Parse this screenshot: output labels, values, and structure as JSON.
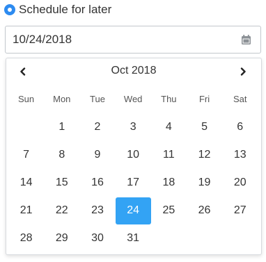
{
  "schedule": {
    "label": "Schedule for later",
    "selected": true
  },
  "date_input": {
    "value": "10/24/2018",
    "icon": "calendar-icon"
  },
  "calendar": {
    "month_title": "Oct 2018",
    "prev_icon": "chevron-left-icon",
    "next_icon": "chevron-right-icon",
    "weekdays": [
      "Sun",
      "Mon",
      "Tue",
      "Wed",
      "Thu",
      "Fri",
      "Sat"
    ],
    "first_weekday_index": 1,
    "days": [
      "1",
      "2",
      "3",
      "4",
      "5",
      "6",
      "7",
      "8",
      "9",
      "10",
      "11",
      "12",
      "13",
      "14",
      "15",
      "16",
      "17",
      "18",
      "19",
      "20",
      "21",
      "22",
      "23",
      "24",
      "25",
      "26",
      "27",
      "28",
      "29",
      "30",
      "31"
    ],
    "selected_day": "24"
  },
  "colors": {
    "accent": "#2d8bf0",
    "selected_day_bg": "#33a3f4",
    "border": "#c2c7cc"
  }
}
